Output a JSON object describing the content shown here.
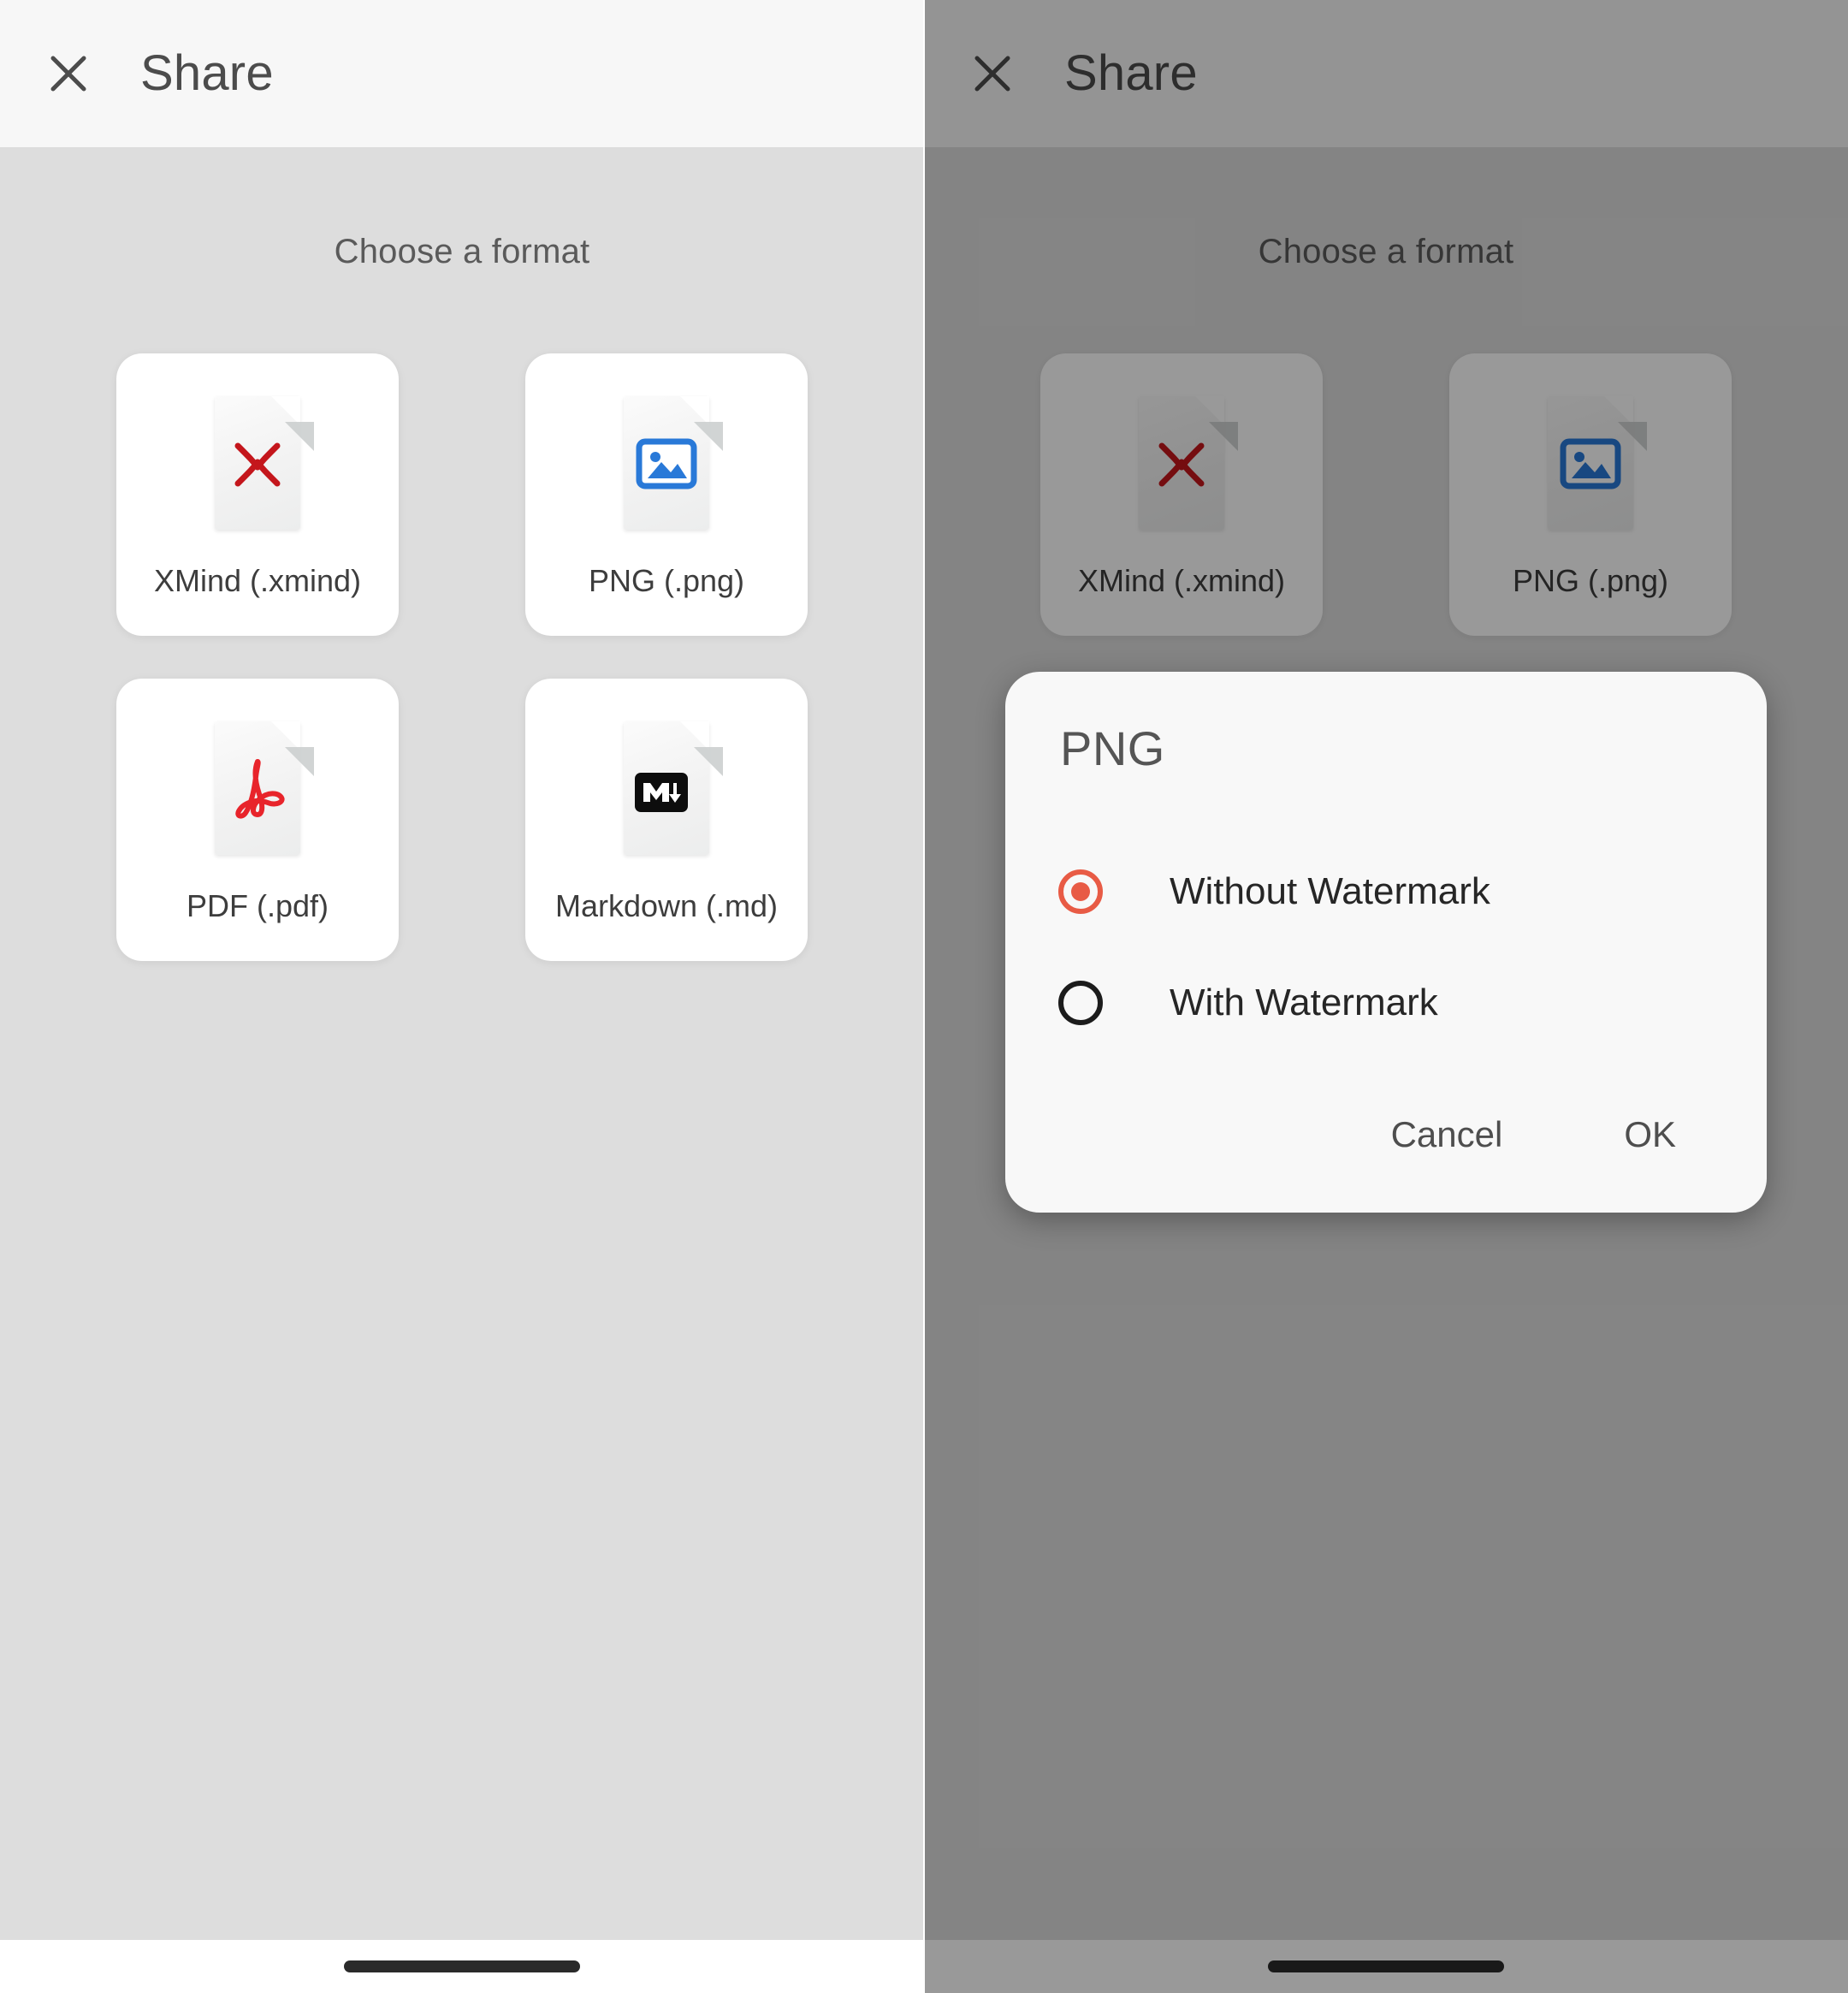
{
  "app": {
    "appbar": {
      "close_icon": "close-icon",
      "title": "Share"
    },
    "section_title": "Choose a format",
    "formats": [
      {
        "label": "XMind (.xmind)",
        "icon": "xmind-file-icon",
        "accent": "#c4161c"
      },
      {
        "label": "PNG (.png)",
        "icon": "png-file-icon",
        "accent": "#2979d8"
      },
      {
        "label": "PDF (.pdf)",
        "icon": "pdf-file-icon",
        "accent": "#e8242b"
      },
      {
        "label": "Markdown (.md)",
        "icon": "markdown-file-icon",
        "accent": "#0d0d0d"
      }
    ]
  },
  "dialog": {
    "title": "PNG",
    "options": [
      {
        "label": "Without Watermark",
        "selected": true
      },
      {
        "label": "With Watermark",
        "selected": false
      }
    ],
    "cancel_label": "Cancel",
    "ok_label": "OK",
    "accent_color": "#e85b45"
  },
  "colors": {
    "panel_background": "#dddddd",
    "appbar_background": "#f7f7f7",
    "card_background": "#ffffff",
    "scrim": "rgba(0,0,0,0.40)",
    "dialog_background": "#f8f8f8",
    "title_text": "#4c4c4c",
    "label_text": "#3d3d3d"
  },
  "panels": [
    {
      "name": "left-panel-formats",
      "dimmed": false
    },
    {
      "name": "right-panel-watermark-dialog",
      "dimmed": true
    }
  ]
}
